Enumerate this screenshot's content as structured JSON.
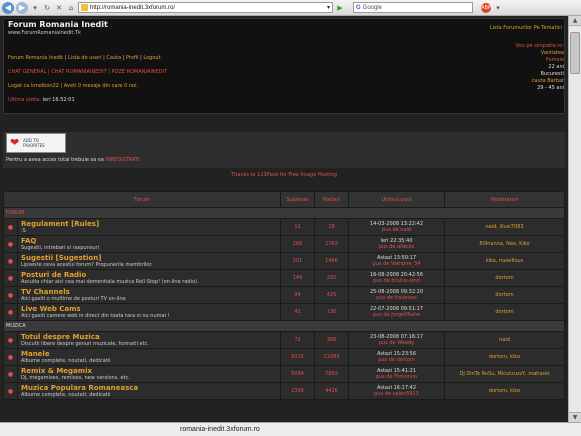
{
  "browser": {
    "url": "http://romania-inedit.3xforum.ro/",
    "search_placeholder": "Google",
    "search_g": "G"
  },
  "header": {
    "title": "Forum Romania Inedit",
    "subtitle": "www.ForumRomaniaInedit.Tk",
    "right_link": "Lista Forumurilor Pe Tematici",
    "nav": [
      "Forum Romania Inedit",
      "Lista de useri",
      "Cauta",
      "Profil",
      "Logout"
    ],
    "nav2": "CHAT GENERAL | CHAT ROMANIAINEDIT | POZE ROMANIAINEDIT",
    "login": "Logat ca kmelbon22 | Aveti 0 mesaje din care 0 noi.",
    "last_visit_label": "Ultima vizita:",
    "last_visit_value": "Ieri 16:52:01",
    "sidebox": {
      "line1": "Vou pe simpatie.ro:",
      "line2": "Vanilatea",
      "line3": "Femeie",
      "line4": "22 ani",
      "line5": "Bucuresti",
      "line6": "cauta Barbat",
      "line7": "29 - 45 ani"
    }
  },
  "favorites": {
    "button_line1": "ADD TO",
    "button_line2": "FAVORITES",
    "text_prefix": "Pentru a avea acces total trebuie sa va",
    "text_link": "INREGISTRATI."
  },
  "thanks": "Thanks to 123Poze for Free Image Hosting",
  "table": {
    "headers": {
      "forum": "Forum",
      "subiecte": "Subiecte",
      "postari": "Postari",
      "ultimul": "Ultimul post",
      "moderatori": "Moderatori"
    },
    "categories": {
      "forum": "FORUM",
      "muzica": "MUZICA"
    },
    "rows": [
      {
        "title": "Regulament [Rules]",
        "desc": ":S",
        "subiecte": "11",
        "postari": "19",
        "last_date": "14-03-2008 13:22:42",
        "last_by": "pus de naid",
        "mods": "naid, illusi7083"
      },
      {
        "title": "FAQ",
        "desc": "Sugestii, intrebari si raspunsuri",
        "subiecte": "266",
        "postari": "2763",
        "last_date": "Ieri 22:35:40",
        "last_by": "pus de allecks",
        "mods": "80Inanna, Neo, Kiko"
      },
      {
        "title": "Sugestii [Sugestion]",
        "desc": "Lipseste ceva acestui forum? Propunerile membrilor.",
        "subiecte": "201",
        "postari": "1466",
        "last_date": "Astazi 13:50:17",
        "last_by": "pus de Vampire_34",
        "mods": "kiko, malefious"
      },
      {
        "title": "Posturi de Radio",
        "desc": "Asculta chiar aici cea mai dementiala muzica Roll-Stop! (on-line radio).",
        "subiecte": "149",
        "postari": "292",
        "last_date": "16-08-2008 20:42:56",
        "last_by": "pus de brutus-smd",
        "mods": "dortom"
      },
      {
        "title": "TV Channels",
        "desc": "Aici gasiti o multime de posturi TV on-line",
        "subiecte": "94",
        "postari": "425",
        "last_date": "25-08-2008 09:32:20",
        "last_by": "pus de fraiaraes",
        "mods": "dortom"
      },
      {
        "title": "Live Web Cams",
        "desc": "Aici gasiti camere web in direct din toata tara si nu numai !",
        "subiecte": "41",
        "postari": "130",
        "last_date": "22-07-2008 09:51:17",
        "last_by": "pus de JorgeVRahe",
        "mods": "dortom"
      },
      {
        "title": "Totul despre Muzica",
        "desc": "Discutii libere despre genuri muzicale, formatii etc.",
        "subiecte": "72",
        "postari": "388",
        "last_date": "23-08-2008 07:16:17",
        "last_by": "pus de Weedy",
        "mods": "naid"
      },
      {
        "title": "Manele",
        "desc": "Albume complete, noutati, dedicatii",
        "subiecte": "5015",
        "postari": "11083",
        "last_date": "Astazi 15:23:56",
        "last_by": "pus de dortom",
        "mods": "dortom, kiko"
      },
      {
        "title": "Remix & Megamix",
        "desc": "Dj, megamixes, remixes, new versions, etc.",
        "subiecte": "5094",
        "postari": "7883",
        "last_date": "Astazi 15:41:21",
        "last_by": "pus de Flonnnnn",
        "mods": "DJ DinTe RoSu, MicutzuzzY, maharet"
      },
      {
        "title": "Muzica Populara Romaneasca",
        "desc": "Albume complete, noutati, dedicatii",
        "subiecte": "2339",
        "postari": "4426",
        "last_date": "Astazi 16:17:42",
        "last_by": "pus de valen5913",
        "mods": "dortom, kiko"
      }
    ]
  },
  "status": "romania-inedit.3xforum.ro"
}
